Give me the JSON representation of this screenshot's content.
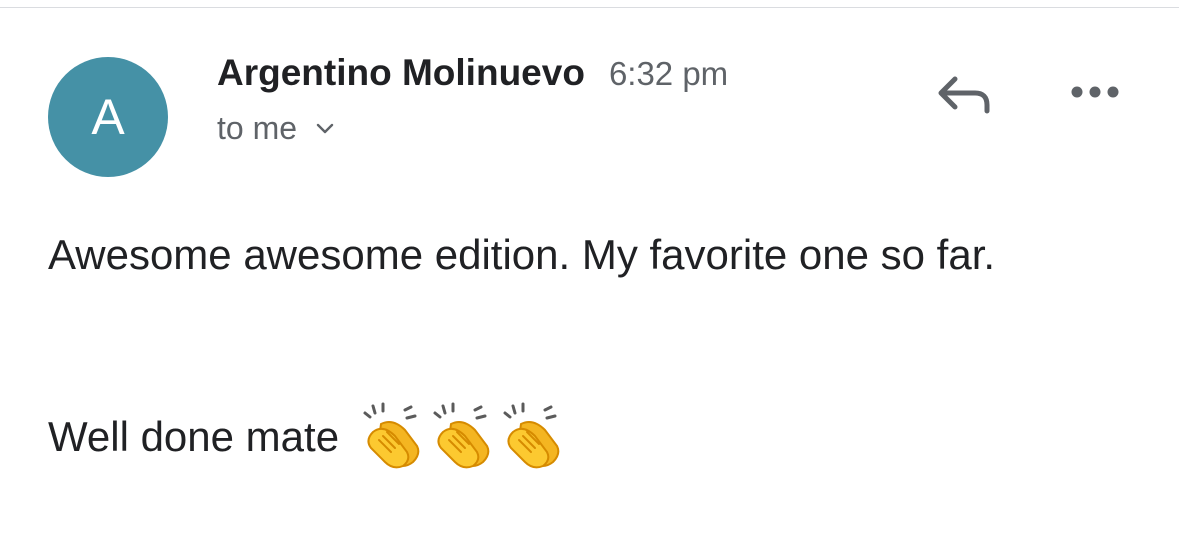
{
  "email": {
    "avatar_letter": "A",
    "avatar_color": "#4591a6",
    "sender_name": "Argentino Molinuevo",
    "time": "6:32 pm",
    "recipient": "to me",
    "body": "Awesome awesome edition. My favorite one so far.",
    "signoff": "Well done mate",
    "signoff_emoji": [
      "clapping-hands",
      "clapping-hands",
      "clapping-hands"
    ]
  },
  "actions": {
    "reply_icon": "reply-arrow-icon",
    "more_icon": "more-horizontal-icon",
    "recipient_toggle_icon": "chevron-down-icon"
  }
}
